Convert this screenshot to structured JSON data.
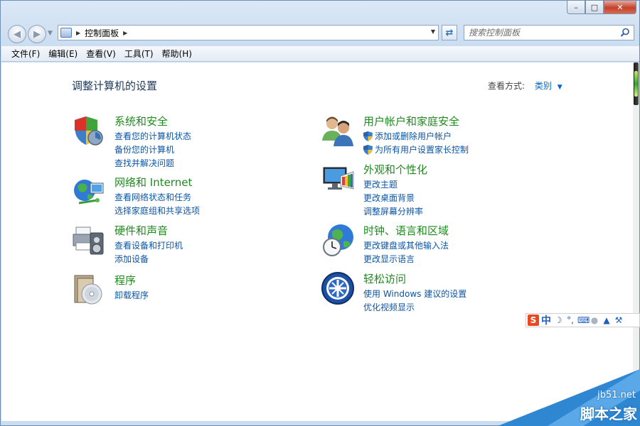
{
  "window": {
    "title": "",
    "buttons": {
      "minimize": "–",
      "maximize": "□",
      "close": "✕"
    }
  },
  "address": {
    "breadcrumb": "控制面板",
    "search_placeholder": "搜索控制面板"
  },
  "menu": [
    "文件(F)",
    "编辑(E)",
    "查看(V)",
    "工具(T)",
    "帮助(H)"
  ],
  "main": {
    "title": "调整计算机的设置",
    "view_by_label": "查看方式:",
    "view_by_value": "类别"
  },
  "categories": [
    {
      "title": "系统和安全",
      "icon": "shield-icon",
      "links": [
        "查看您的计算机状态",
        "备份您的计算机",
        "查找并解决问题"
      ]
    },
    {
      "title": "网络和 Internet",
      "icon": "network-globe-icon",
      "links": [
        "查看网络状态和任务",
        "选择家庭组和共享选项"
      ]
    },
    {
      "title": "硬件和声音",
      "icon": "printer-speaker-icon",
      "links": [
        "查看设备和打印机",
        "添加设备"
      ]
    },
    {
      "title": "程序",
      "icon": "programs-disc-icon",
      "links": [
        "卸载程序"
      ]
    },
    {
      "title": "用户帐户和家庭安全",
      "icon": "users-icon",
      "links": [
        "添加或删除用户帐户",
        "为所有用户设置家长控制"
      ]
    },
    {
      "title": "外观和个性化",
      "icon": "monitor-palette-icon",
      "links": [
        "更改主题",
        "更改桌面背景",
        "调整屏幕分辨率"
      ]
    },
    {
      "title": "时钟、语言和区域",
      "icon": "clock-globe-icon",
      "links": [
        "更改键盘或其他输入法",
        "更改显示语言"
      ]
    },
    {
      "title": "轻松访问",
      "icon": "ease-of-access-icon",
      "links": [
        "使用 Windows 建议的设置",
        "优化视频显示"
      ]
    }
  ],
  "ime": {
    "logo": "S",
    "mode": "中"
  },
  "watermark": {
    "url": "jb51.net",
    "name": "脚本之家"
  }
}
